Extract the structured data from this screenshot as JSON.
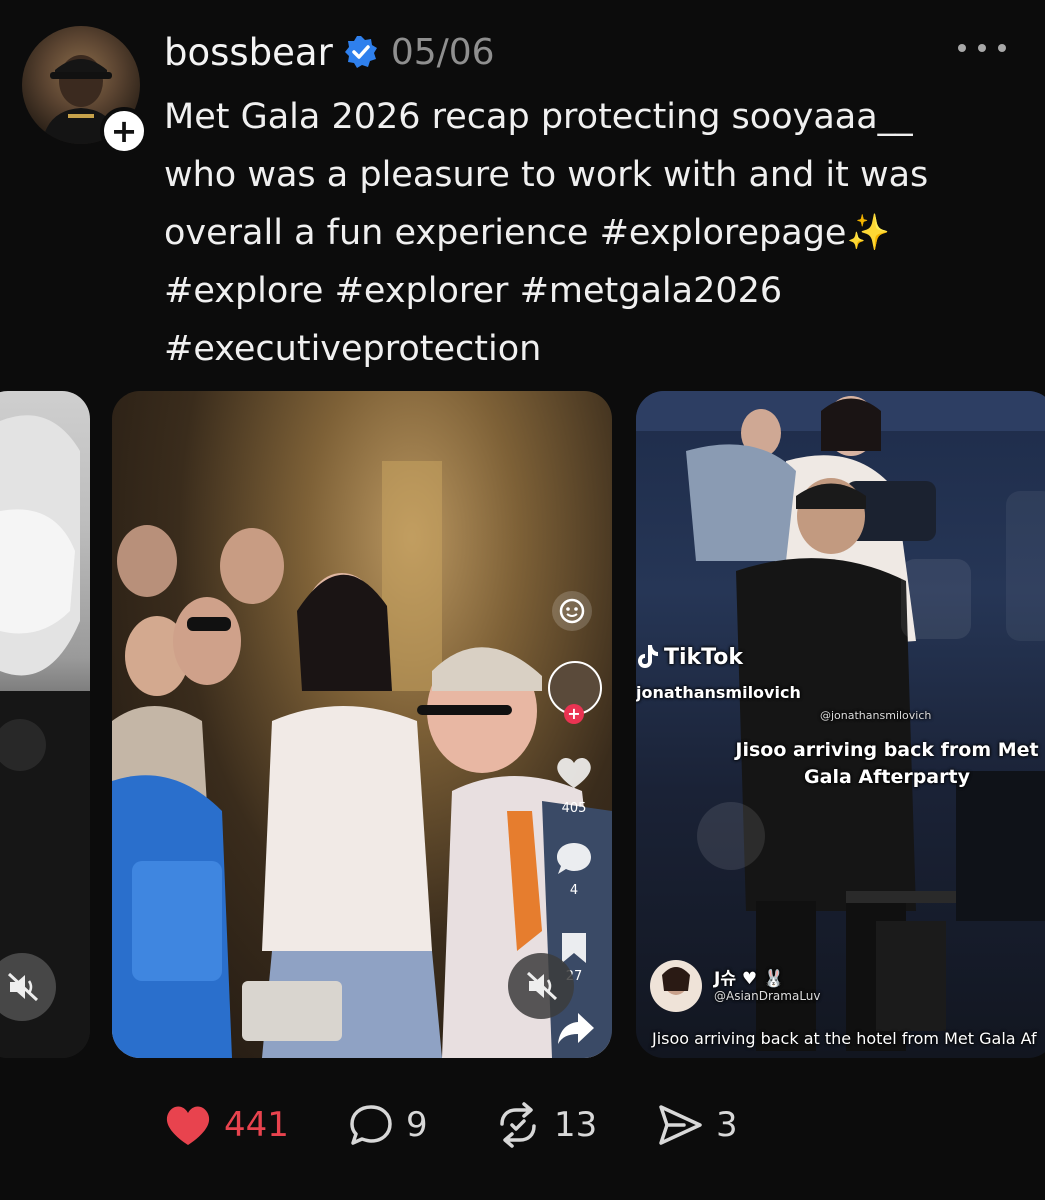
{
  "post": {
    "username": "bossbear",
    "date": "05/06",
    "verified": true,
    "caption_lines": [
      "Met Gala 2026 recap protecting sooyaaa__",
      "who was a pleasure to work with and it was",
      "overall a fun experience #explorepage✨",
      "#explore #explorer #metgala2026",
      "#executiveprotection"
    ]
  },
  "media": {
    "center_video": {
      "like_count": "405",
      "comment_count": "4",
      "save_count": "27"
    },
    "right_video": {
      "brand": "TikTok",
      "handle": "jonathansmilovich",
      "watermark": "@jonathansmilovich",
      "caption": "Jisoo arriving back from Met Gala Afterparty",
      "commenter_name": "J슈 ♥ 🐰",
      "commenter_handle": "@AsianDramaLuv",
      "bottom_caption": "Jisoo arriving back at the hotel from Met Gala Af"
    }
  },
  "actions": {
    "likes": "441",
    "comments": "9",
    "reposts": "13",
    "shares": "3"
  },
  "colors": {
    "accent_like": "#e8434e",
    "verified_blue": "#2f80ed",
    "background": "#0c0c0c"
  }
}
